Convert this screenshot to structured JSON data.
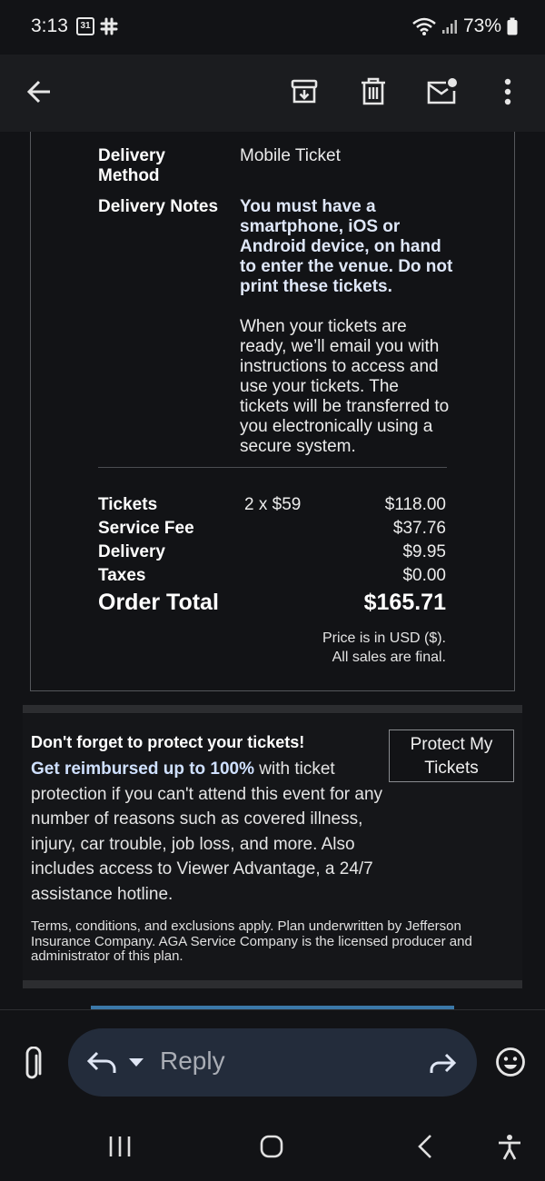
{
  "status_bar": {
    "time": "3:13",
    "calendar_day": "31",
    "battery": "73%"
  },
  "toolbar": {
    "icons": [
      "back-arrow-icon",
      "archive-icon",
      "trash-icon",
      "mark-unread-icon",
      "more-vert-icon"
    ]
  },
  "order": {
    "delivery_method_label": "Delivery Method",
    "delivery_method_value": "Mobile Ticket",
    "delivery_notes_label": "Delivery Notes",
    "delivery_notes_bold": "You must have a smartphone, iOS or Android device, on hand to enter the venue. Do not print these tickets.",
    "delivery_notes_text": "When your tickets are ready, we’ll email you with instructions to access and use your tickets. The tickets will be transferred to you electronically using a secure system.",
    "lines": [
      {
        "label": "Tickets",
        "qty": "2 x $59",
        "amount": "$118.00"
      },
      {
        "label": "Service Fee",
        "qty": "",
        "amount": "$37.76"
      },
      {
        "label": "Delivery",
        "qty": "",
        "amount": "$9.95"
      },
      {
        "label": "Taxes",
        "qty": "",
        "amount": "$0.00"
      }
    ],
    "total_label": "Order Total",
    "total_amount": "$165.71",
    "price_note": "Price is in USD ($).",
    "sales_note": "All sales are final."
  },
  "protection": {
    "heading": "Don't forget to protect your tickets!",
    "highlight": "Get reimbursed up to 100%",
    "body": " with ticket protection if you can't attend this event for any number of reasons such as covered illness, injury, car trouble, job loss, and more. Also includes access to Viewer Advantage, a 24/7 assistance hotline.",
    "button_label": "Protect My Tickets",
    "terms": "Terms, conditions, and exclusions apply. Plan underwritten by Jefferson Insurance Company. AGA Service Company is the licensed producer and administrator of this plan."
  },
  "reply_bar": {
    "reply_label": "Reply"
  },
  "colors": {
    "background": "#121316",
    "toolbar": "#1b1c1f",
    "reply_pill": "#232c3b",
    "highlight_text": "#cfe0ff",
    "blue_strip": "#3b78a8"
  }
}
